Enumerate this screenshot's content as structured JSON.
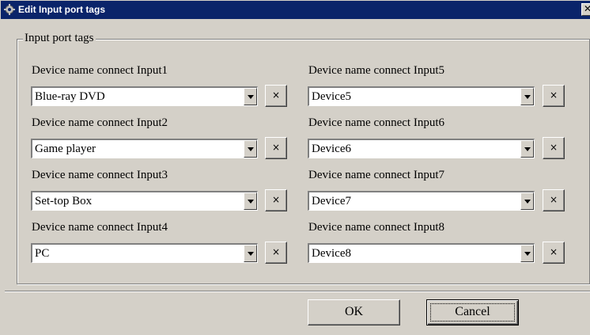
{
  "window": {
    "title": "Edit Input port tags",
    "close_glyph": "✕"
  },
  "group": {
    "legend": "Input port tags"
  },
  "inputs": [
    {
      "label": "Device name connect Input1",
      "value": "Blue-ray DVD",
      "clear": "×"
    },
    {
      "label": "Device name connect Input2",
      "value": "Game player",
      "clear": "×"
    },
    {
      "label": "Device name connect Input3",
      "value": "Set-top Box",
      "clear": "×"
    },
    {
      "label": "Device name connect Input4",
      "value": "PC",
      "clear": "×"
    },
    {
      "label": "Device name connect Input5",
      "value": "Device5",
      "clear": "×"
    },
    {
      "label": "Device name connect Input6",
      "value": "Device6",
      "clear": "×"
    },
    {
      "label": "Device name connect Input7",
      "value": "Device7",
      "clear": "×"
    },
    {
      "label": "Device name connect Input8",
      "value": "Device8",
      "clear": "×"
    }
  ],
  "buttons": {
    "ok": "OK",
    "cancel": "Cancel"
  },
  "icons": {
    "title": "gear-icon",
    "dropdown": "chevron-down-icon",
    "clear": "close-icon"
  },
  "colors": {
    "titlebar": "#0a246a",
    "face": "#d4d0c8"
  }
}
